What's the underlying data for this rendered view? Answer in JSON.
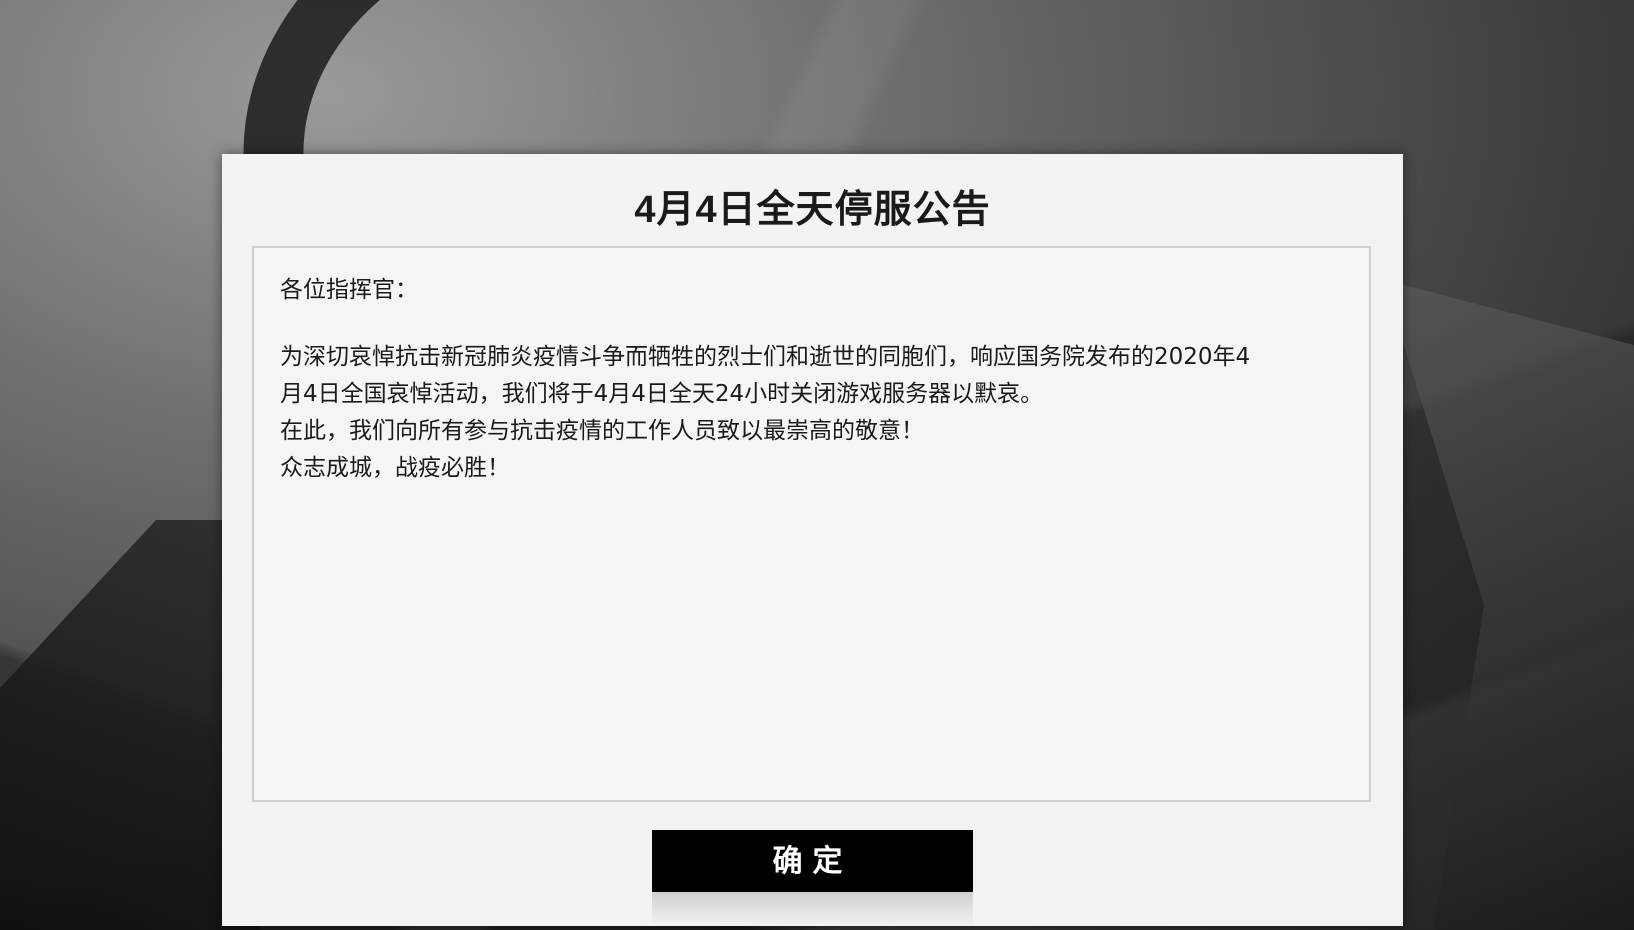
{
  "dialog": {
    "title": "4月4日全天停服公告",
    "body": {
      "greeting": "各位指挥官：",
      "paragraph_1_line_1": "为深切哀悼抗击新冠肺炎疫情斗争而牺牲的烈士们和逝世的同胞们，响应国务院发布的2020年4",
      "paragraph_1_line_2": "月4日全国哀悼活动，我们将于4月4日全天24小时关闭游戏服务器以默哀。",
      "paragraph_2": "在此，我们向所有参与抗击疫情的工作人员致以最崇高的敬意！",
      "paragraph_3": "众志成城，战疫必胜！"
    },
    "confirm_label": "确定"
  },
  "colors": {
    "dialog_background": "#f3f3f3",
    "button_background": "#000000",
    "button_text": "#ffffff"
  }
}
